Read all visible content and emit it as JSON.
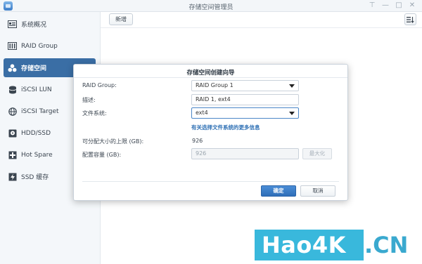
{
  "window": {
    "title": "存储空间管理员"
  },
  "sidebar": {
    "items": [
      {
        "label": "系统概况",
        "icon": "overview-icon"
      },
      {
        "label": "RAID Group",
        "icon": "raid-icon"
      },
      {
        "label": "存储空间",
        "icon": "volume-icon",
        "active": true
      },
      {
        "label": "iSCSI LUN",
        "icon": "lun-icon"
      },
      {
        "label": "iSCSI Target",
        "icon": "target-icon"
      },
      {
        "label": "HDD/SSD",
        "icon": "disk-icon"
      },
      {
        "label": "Hot Spare",
        "icon": "hot-spare-icon"
      },
      {
        "label": "SSD 缓存",
        "icon": "ssd-cache-icon"
      }
    ]
  },
  "toolbar": {
    "create_label": "新增"
  },
  "dialog": {
    "title": "存储空间创建向导",
    "raid_group_label": "RAID Group:",
    "raid_group_value": "RAID Group 1",
    "description_label": "描述:",
    "description_value": "RAID 1, ext4",
    "filesystem_label": "文件系统:",
    "filesystem_value": "ext4",
    "filesystem_link": "有关选择文件系统的更多信息",
    "max_size_label": "可分配大小的上限 (GB):",
    "max_size_value": "926",
    "capacity_label": "配置容量 (GB):",
    "capacity_value": "926",
    "maximize_label": "最大化",
    "ok_label": "确定",
    "cancel_label": "取消"
  },
  "watermark": {
    "text_left": "Hao4K",
    "text_right": ".CN"
  },
  "colors": {
    "accent": "#3a6ea5",
    "primary_button": "#2f6fb9",
    "link": "#2d6fb4",
    "watermark": "#39b8dc"
  }
}
